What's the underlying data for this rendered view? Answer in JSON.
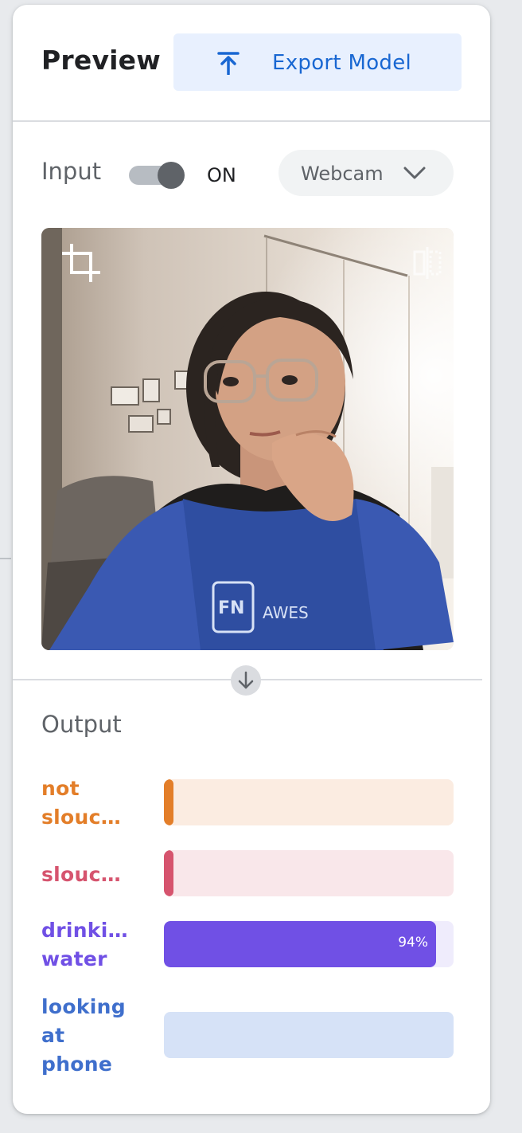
{
  "header": {
    "title": "Preview",
    "export_label": "Export Model",
    "export_icon": "upload-icon"
  },
  "input": {
    "label": "Input",
    "toggle_state": "ON",
    "toggle_on": true,
    "source": "Webcam"
  },
  "webcam": {
    "crop_icon": "crop-icon",
    "flip_icon": "flip-horizontal-icon",
    "shirt_text": "FN AWES"
  },
  "output": {
    "label": "Output",
    "classes": [
      {
        "label": "not\nslouc…",
        "confidence": 0.03,
        "pct_text": "",
        "color": "#e37e29",
        "track": "#fbece1"
      },
      {
        "label": "slouc…",
        "confidence": 0.03,
        "pct_text": "",
        "color": "#d6546e",
        "track": "#f9e7ea"
      },
      {
        "label": "drinki…\nwater",
        "confidence": 0.94,
        "pct_text": "94%",
        "color": "#7050e5",
        "track": "#efecfc"
      },
      {
        "label": "looking\nat\nphone",
        "confidence": 0.0,
        "pct_text": "",
        "color": "#3f6fcc",
        "track": "#d6e2f7"
      }
    ]
  },
  "colors": {
    "accent": "#1967d2",
    "export_bg": "#e8f0fe"
  }
}
